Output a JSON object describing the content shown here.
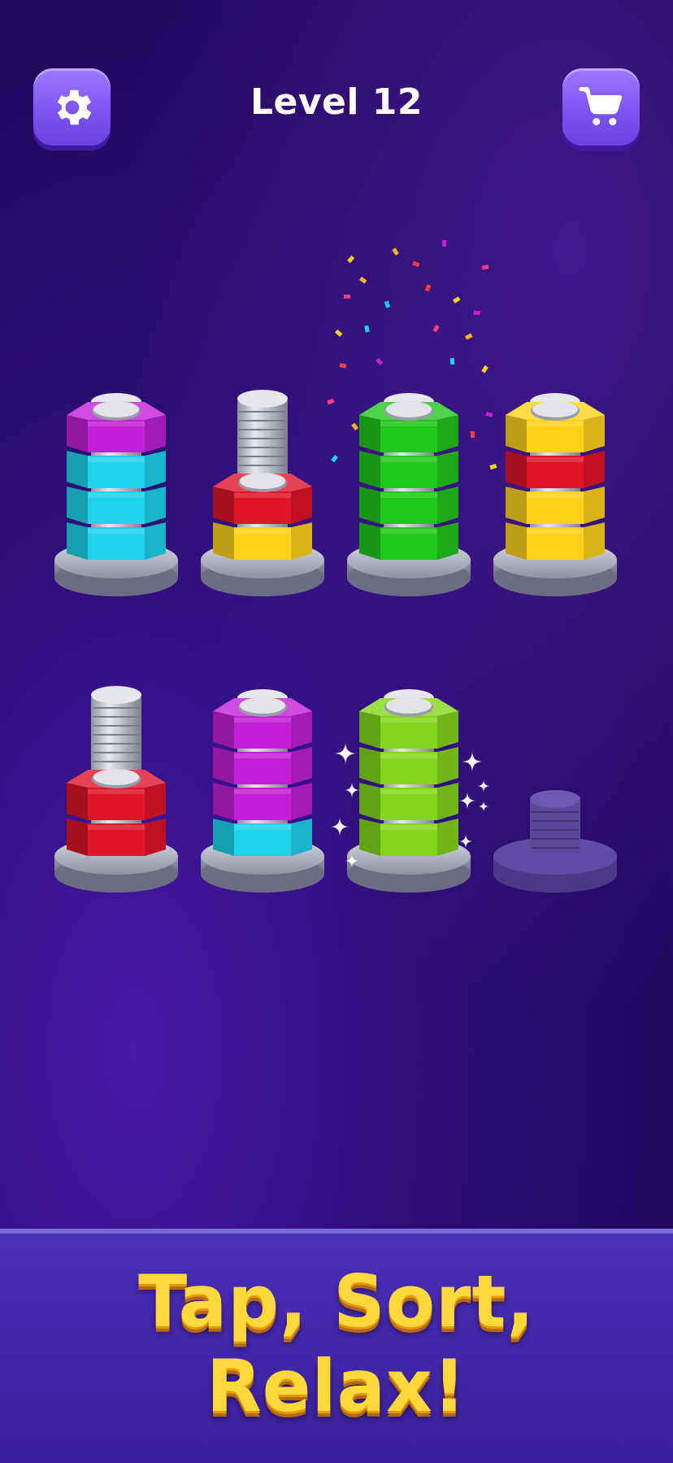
{
  "header": {
    "level_label": "Level 12",
    "settings_icon": "gear-icon",
    "shop_icon": "shopping-cart-icon"
  },
  "colors": {
    "magenta": "#c21fd6",
    "cyan": "#1fd3ea",
    "red": "#e0152a",
    "yellow": "#ffd21a",
    "green": "#22c71c",
    "lime": "#84d61c"
  },
  "board": {
    "rows": [
      [
        {
          "nuts": [
            "cyan",
            "cyan",
            "cyan",
            "magenta"
          ],
          "state": "normal"
        },
        {
          "nuts": [
            "yellow",
            "red"
          ],
          "state": "normal"
        },
        {
          "nuts": [
            "green",
            "green",
            "green",
            "green"
          ],
          "state": "completed-confetti"
        },
        {
          "nuts": [
            "yellow",
            "yellow",
            "red",
            "yellow"
          ],
          "state": "normal"
        }
      ],
      [
        {
          "nuts": [
            "red",
            "red"
          ],
          "state": "normal"
        },
        {
          "nuts": [
            "cyan",
            "magenta",
            "magenta",
            "magenta"
          ],
          "state": "normal"
        },
        {
          "nuts": [
            "lime",
            "lime",
            "lime",
            "lime"
          ],
          "state": "completed-sparkle"
        },
        {
          "nuts": [],
          "state": "locked"
        }
      ]
    ]
  },
  "footer": {
    "slogan_line1": "Tap, Sort,",
    "slogan_line2": "Relax!"
  }
}
